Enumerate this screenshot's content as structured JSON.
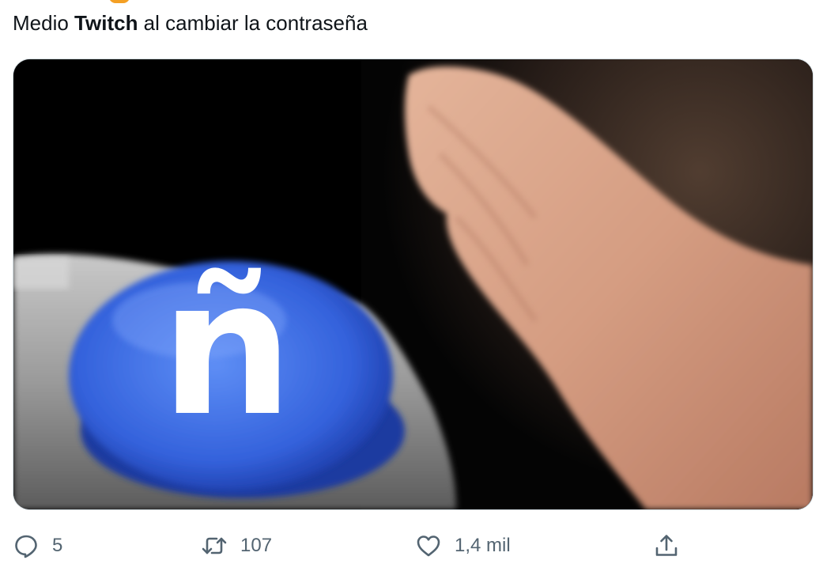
{
  "tweet": {
    "text_before": "Medio ",
    "text_bold": "Twitch",
    "text_after": " al cambiar la contraseña"
  },
  "media": {
    "button_glyph": "ñ",
    "button_color": "#2f5fd6"
  },
  "actions": {
    "reply": {
      "icon": "reply-icon",
      "count": "5"
    },
    "retweet": {
      "icon": "retweet-icon",
      "count": "107"
    },
    "like": {
      "icon": "heart-icon",
      "count": "1,4 mil"
    },
    "share": {
      "icon": "share-icon"
    }
  }
}
